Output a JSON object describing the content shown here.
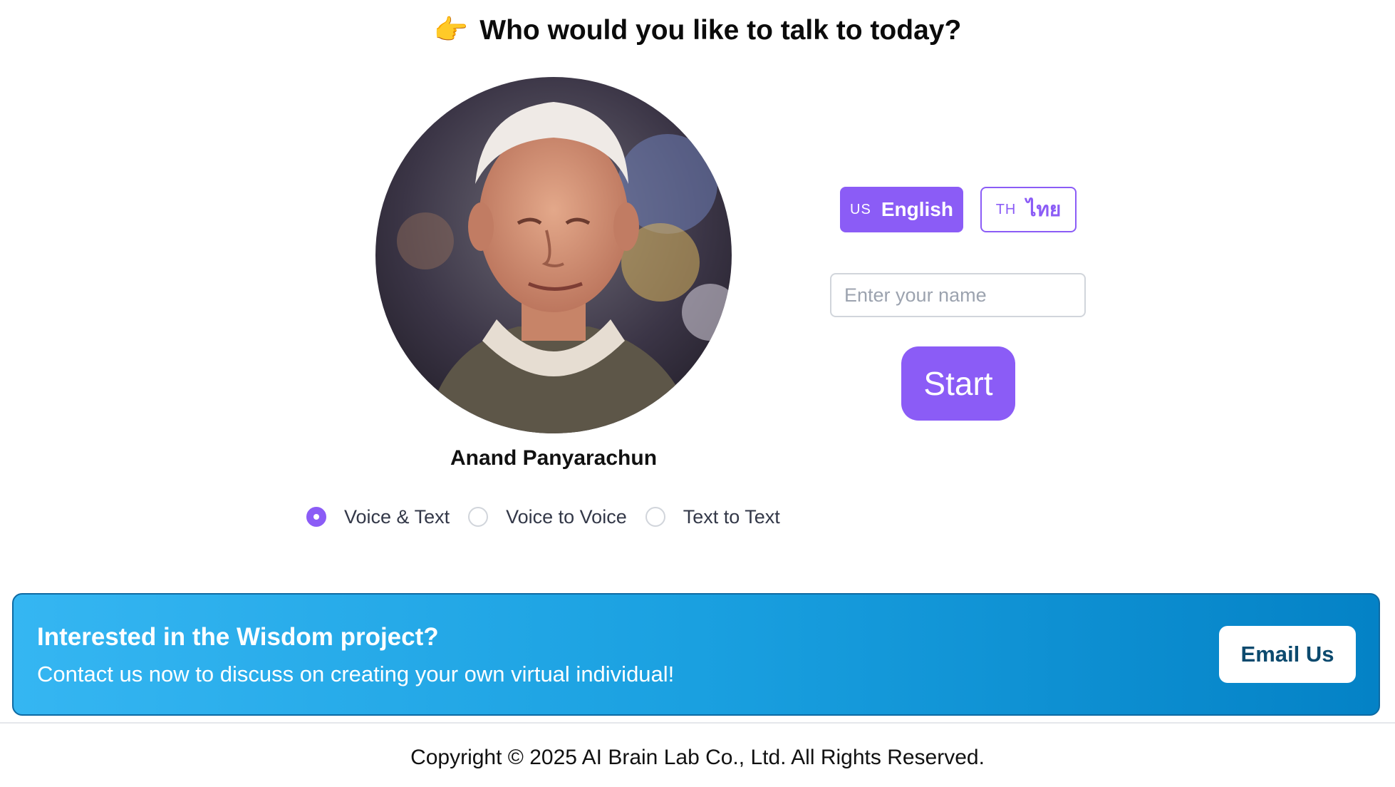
{
  "header": {
    "emoji": "👉",
    "title": "Who would you like to talk to today?"
  },
  "persona": {
    "name": "Anand Panyarachun"
  },
  "modes": [
    {
      "label": "Voice & Text",
      "selected": true
    },
    {
      "label": "Voice to Voice",
      "selected": false
    },
    {
      "label": "Text to Text",
      "selected": false
    }
  ],
  "languages": [
    {
      "code": "US",
      "name": "English",
      "active": true
    },
    {
      "code": "TH",
      "name": "ไทย",
      "active": false
    }
  ],
  "name_input": {
    "placeholder": "Enter your name",
    "value": ""
  },
  "start": {
    "label": "Start"
  },
  "banner": {
    "title": "Interested in the Wisdom project?",
    "subtitle": "Contact us now to discuss on creating your own virtual individual!",
    "button_label": "Email Us"
  },
  "footer": {
    "copyright": "Copyright © 2025 AI Brain Lab Co., Ltd. All Rights Reserved."
  },
  "colors": {
    "accent": "#8b5cf6",
    "banner_start": "#35b6f2",
    "banner_end": "#0482c6"
  }
}
